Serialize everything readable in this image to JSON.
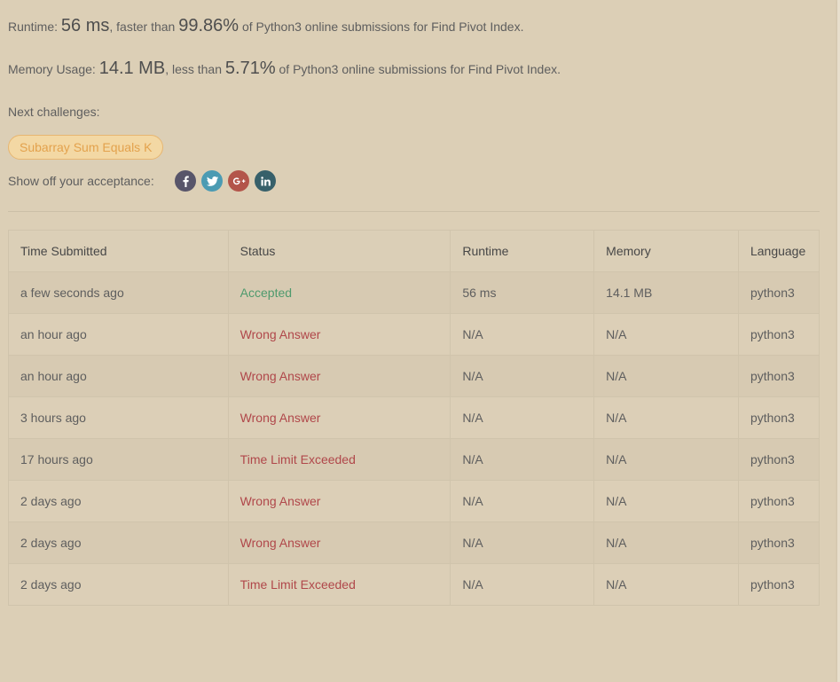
{
  "runtime": {
    "label": "Runtime:",
    "value": "56 ms",
    "mid": ", faster than",
    "percent": "99.86%",
    "suffix": "of Python3 online submissions for Find Pivot Index."
  },
  "memory": {
    "label": "Memory Usage:",
    "value": "14.1 MB",
    "mid": ", less than",
    "percent": "5.71%",
    "suffix": "of Python3 online submissions for Find Pivot Index."
  },
  "next_challenges": {
    "label": "Next challenges:",
    "items": [
      "Subarray Sum Equals K"
    ]
  },
  "share": {
    "label": "Show off your acceptance:",
    "icons": [
      {
        "name": "facebook-icon",
        "glyph": "f"
      },
      {
        "name": "twitter-icon",
        "glyph": "t"
      },
      {
        "name": "google-plus-icon",
        "glyph": "G+"
      },
      {
        "name": "linkedin-icon",
        "glyph": "in"
      }
    ]
  },
  "colors": {
    "accepted": "#4e9a6d",
    "error": "#b0474a",
    "tag_text": "#e3a24d",
    "tag_bg": "#f3d8a4",
    "background": "#dccfb6"
  },
  "table": {
    "headers": [
      "Time Submitted",
      "Status",
      "Runtime",
      "Memory",
      "Language"
    ],
    "rows": [
      {
        "time": "a few seconds ago",
        "status": "Accepted",
        "runtime": "56 ms",
        "memory": "14.1 MB",
        "language": "python3"
      },
      {
        "time": "an hour ago",
        "status": "Wrong Answer",
        "runtime": "N/A",
        "memory": "N/A",
        "language": "python3"
      },
      {
        "time": "an hour ago",
        "status": "Wrong Answer",
        "runtime": "N/A",
        "memory": "N/A",
        "language": "python3"
      },
      {
        "time": "3 hours ago",
        "status": "Wrong Answer",
        "runtime": "N/A",
        "memory": "N/A",
        "language": "python3"
      },
      {
        "time": "17 hours ago",
        "status": "Time Limit Exceeded",
        "runtime": "N/A",
        "memory": "N/A",
        "language": "python3"
      },
      {
        "time": "2 days ago",
        "status": "Wrong Answer",
        "runtime": "N/A",
        "memory": "N/A",
        "language": "python3"
      },
      {
        "time": "2 days ago",
        "status": "Wrong Answer",
        "runtime": "N/A",
        "memory": "N/A",
        "language": "python3"
      },
      {
        "time": "2 days ago",
        "status": "Time Limit Exceeded",
        "runtime": "N/A",
        "memory": "N/A",
        "language": "python3"
      }
    ]
  }
}
